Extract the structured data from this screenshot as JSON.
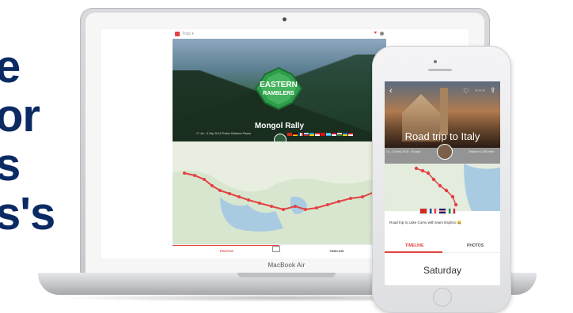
{
  "headline": [
    "e",
    "or",
    "s",
    "s's"
  ],
  "laptop": {
    "brand": "MacBook Air",
    "app": {
      "title": "Mongol Rally",
      "badge_line1": "EASTERN",
      "badge_line2": "RAMBLERS",
      "stats": "17 Jul – 9 Sep 2014   Photos  Distance   Places",
      "tab_photos": "PHOTOS",
      "tab_timeline": "TIMELINE",
      "topbar_text": "Trips ▾"
    }
  },
  "phone": {
    "title": "Road trip to Italy",
    "stats_left": "14 – 30 May 2015 · 16 days",
    "stats_right": "Distance 1,636 miles",
    "caption": "Road trip to Lake Como with team Esploro 😄",
    "tab_timeline": "TIMELINE",
    "tab_photos": "PHOTOS",
    "day": "Saturday"
  },
  "colors": {
    "accent": "#e34242",
    "headline": "#0b2a63"
  }
}
